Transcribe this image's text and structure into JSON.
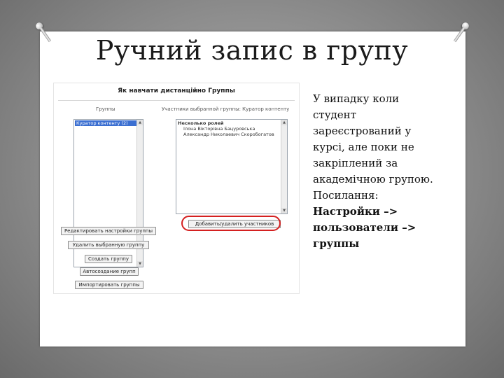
{
  "slide": {
    "title": "Ручний запис в групу",
    "description_lines": [
      "У випадку коли",
      "студент",
      "зареєстрований у",
      "курсі, але поки не",
      "закріплений за",
      "академічною групою.",
      "Посилання:"
    ],
    "path_lines": [
      "Настройки –>",
      "пользователи –>",
      "группы"
    ]
  },
  "screenshot": {
    "heading": "Як навчати дистанційно Группы",
    "groups_column_header": "Группы",
    "members_column_header": "Участники выбранной группы: Куратор контенту",
    "groups_list": [
      "Куратор контенту (2)"
    ],
    "members_list": {
      "role_header": "Несколько ролей",
      "members": [
        "Ілона Вікторівна Бацуровська",
        "Александр Николаевич Скоробогатов"
      ]
    },
    "buttons": {
      "edit_group_settings": "Редактировать настройки группы",
      "delete_selected_group": "Удалить выбранную группу",
      "create_group": "Создать группу",
      "auto_create_groups": "Автосоздание групп",
      "import_groups": "Импортировать группы",
      "add_remove_participants": "Добавить/удалить участников"
    },
    "highlight_color": "#d42020"
  }
}
